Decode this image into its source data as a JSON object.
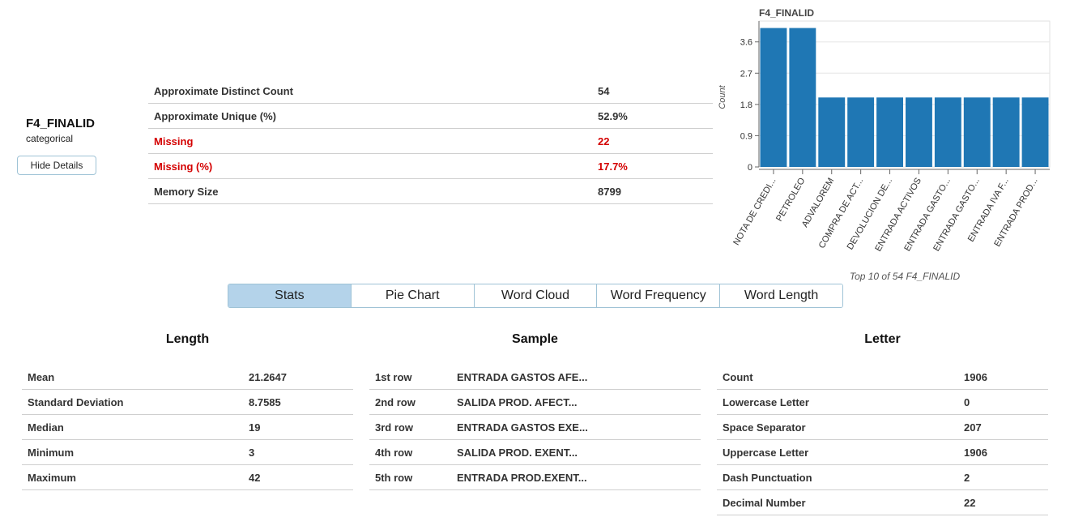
{
  "variable": {
    "name": "F4_FINALID",
    "type": "categorical",
    "hide_details_label": "Hide Details"
  },
  "overview": [
    {
      "label": "Approximate Distinct Count",
      "value": "54",
      "warn": false
    },
    {
      "label": "Approximate Unique (%)",
      "value": "52.9%",
      "warn": false
    },
    {
      "label": "Missing",
      "value": "22",
      "warn": true
    },
    {
      "label": "Missing (%)",
      "value": "17.7%",
      "warn": true
    },
    {
      "label": "Memory Size",
      "value": "8799",
      "warn": false
    }
  ],
  "chart_data": {
    "type": "bar",
    "title": "F4_FINALID",
    "ylabel": "Count",
    "xlabel": "Top 10 of 54 F4_FINALID",
    "categories": [
      "NOTA DE CREDI...",
      "PETROLEO",
      "ADVALOREM",
      "COMPRA DE ACT...",
      "DEVOLUCION DE...",
      "ENTRADA ACTIVOS",
      "ENTRADA GASTO...",
      "ENTRADA GASTO...",
      "ENTRADA IVA F...",
      "ENTRADA PROD..."
    ],
    "values": [
      4,
      4,
      2,
      2,
      2,
      2,
      2,
      2,
      2,
      2
    ],
    "yticks": [
      0,
      0.9,
      1.8,
      2.7,
      3.6
    ],
    "ylim": [
      0,
      4.2
    ],
    "grid": true,
    "color": "#1f77b4"
  },
  "tabs": [
    "Stats",
    "Pie Chart",
    "Word Cloud",
    "Word Frequency",
    "Word Length"
  ],
  "active_tab": "Stats",
  "length": {
    "title": "Length",
    "rows": [
      {
        "label": "Mean",
        "value": "21.2647"
      },
      {
        "label": "Standard Deviation",
        "value": "8.7585"
      },
      {
        "label": "Median",
        "value": "19"
      },
      {
        "label": "Minimum",
        "value": "3"
      },
      {
        "label": "Maximum",
        "value": "42"
      }
    ]
  },
  "sample": {
    "title": "Sample",
    "rows": [
      {
        "label": "1st row",
        "value": "ENTRADA GASTOS AFE..."
      },
      {
        "label": "2nd row",
        "value": "SALIDA PROD. AFECT..."
      },
      {
        "label": "3rd row",
        "value": "ENTRADA GASTOS EXE..."
      },
      {
        "label": "4th row",
        "value": "SALIDA PROD. EXENT..."
      },
      {
        "label": "5th row",
        "value": "ENTRADA PROD.EXENT..."
      }
    ]
  },
  "letter": {
    "title": "Letter",
    "rows": [
      {
        "label": "Count",
        "value": "1906"
      },
      {
        "label": "Lowercase Letter",
        "value": "0"
      },
      {
        "label": "Space Separator",
        "value": "207"
      },
      {
        "label": "Uppercase Letter",
        "value": "1906"
      },
      {
        "label": "Dash Punctuation",
        "value": "2"
      },
      {
        "label": "Decimal Number",
        "value": "22"
      }
    ]
  }
}
